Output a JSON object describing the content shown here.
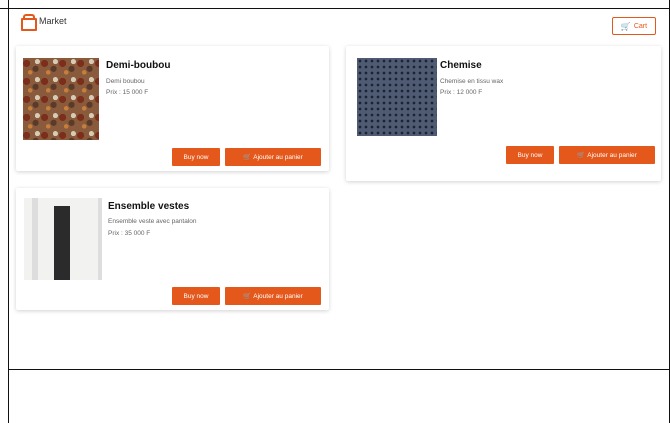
{
  "header": {
    "brand": "Market",
    "cart_label": "Cart"
  },
  "colors": {
    "accent": "#e4581c"
  },
  "products": [
    {
      "name": "Demi-boubou",
      "description": "Demi boubou",
      "price": "Prix : 15 000 F",
      "buy_label": "Buy now",
      "add_label": "Ajouter au panier"
    },
    {
      "name": "Chemise",
      "description": "Chemise en tissu wax",
      "price": "Prix : 12 000 F",
      "buy_label": "Buy now",
      "add_label": "Ajouter au panier"
    },
    {
      "name": "Ensemble vestes",
      "description": "Ensemble veste avec pantalon",
      "price": "Prix : 35 000 F",
      "buy_label": "Buy now",
      "add_label": "Ajouter au panier"
    }
  ],
  "icons": {
    "logo": "shop-bag-icon",
    "cart": "cart-icon"
  }
}
